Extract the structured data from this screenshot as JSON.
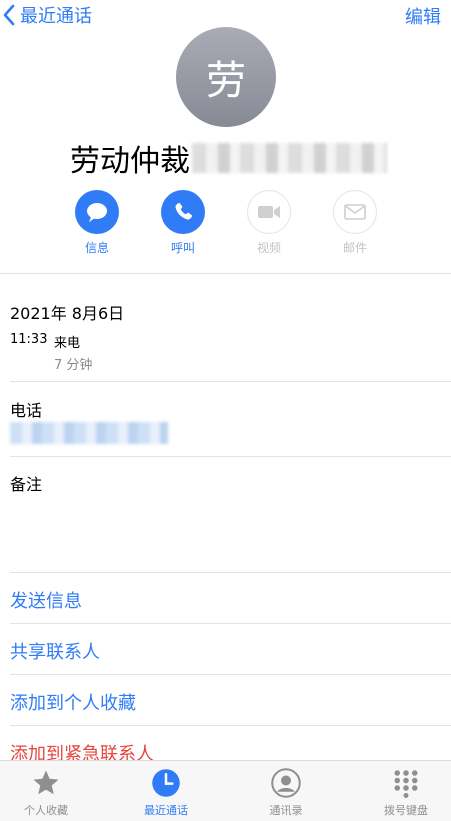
{
  "nav": {
    "back_label": "最近通话",
    "edit_label": "编辑"
  },
  "contact": {
    "avatar_initial": "劳",
    "name": "劳动仲裁"
  },
  "actions": [
    {
      "label": "信息",
      "icon": "message-icon",
      "enabled": true
    },
    {
      "label": "呼叫",
      "icon": "phone-icon",
      "enabled": true
    },
    {
      "label": "视频",
      "icon": "video-icon",
      "enabled": false
    },
    {
      "label": "邮件",
      "icon": "mail-icon",
      "enabled": false
    }
  ],
  "call": {
    "date": "2021年 8月6日",
    "time": "11:33",
    "type": "来电",
    "duration": "7 分钟"
  },
  "phone": {
    "label": "电话"
  },
  "notes": {
    "label": "备注"
  },
  "menu": {
    "send_message": "发送信息",
    "share_contact": "共享联系人",
    "add_favorite": "添加到个人收藏",
    "add_emergency": "添加到紧急联系人"
  },
  "tabs": [
    {
      "label": "个人收藏",
      "icon": "star-icon",
      "active": false
    },
    {
      "label": "最近通话",
      "icon": "clock-icon",
      "active": true
    },
    {
      "label": "通讯录",
      "icon": "contacts-icon",
      "active": false
    },
    {
      "label": "拨号键盘",
      "icon": "keypad-icon",
      "active": false
    }
  ],
  "colors": {
    "accent": "#2f7cf6",
    "destructive": "#e5463d",
    "inactive": "#c4c4c6"
  }
}
